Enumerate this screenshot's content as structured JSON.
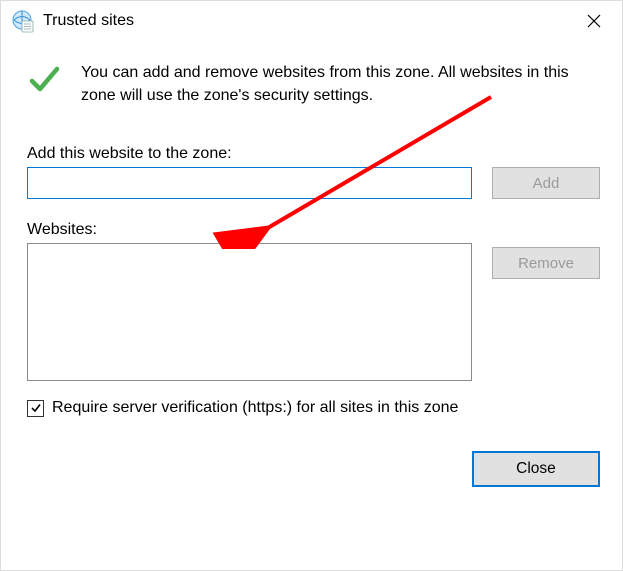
{
  "window": {
    "title": "Trusted sites"
  },
  "info": {
    "text": "You can add and remove websites from this zone. All websites in this zone will use the zone's security settings."
  },
  "add": {
    "label": "Add this website to the zone:",
    "value": "",
    "button": "Add"
  },
  "websites": {
    "label": "Websites:",
    "remove_button": "Remove"
  },
  "checkbox": {
    "checked": true,
    "label": "Require server verification (https:) for all sites in this zone"
  },
  "footer": {
    "close": "Close"
  }
}
